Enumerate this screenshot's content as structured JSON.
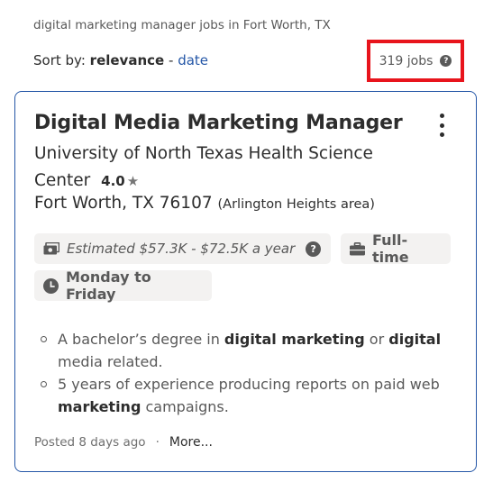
{
  "search": {
    "query_text": "digital marketing manager jobs in Fort Worth, TX"
  },
  "sort": {
    "label": "Sort by:",
    "active": "relevance",
    "separator": "-",
    "alternate": "date"
  },
  "results": {
    "count_label": "319 jobs",
    "help_glyph": "?"
  },
  "job": {
    "title": "Digital Media Marketing Manager",
    "company": "University of North Texas Health Science Center",
    "rating": "4.0",
    "rating_star": "★",
    "location": "Fort Worth, TX 76107",
    "location_area": "(Arlington Heights area)",
    "salary": "Estimated $57.3K - $72.5K a year",
    "salary_help_glyph": "?",
    "job_type": "Full-time",
    "schedule": "Monday to Friday",
    "bullets": [
      {
        "t1": "A bachelor’s degree in ",
        "b1": "digital marketing",
        "t2": " or ",
        "b2": "digital",
        "t3": " media related."
      },
      {
        "t1": "5 years of experience producing reports on paid web ",
        "b1": "marketing",
        "t2": " campaigns."
      }
    ],
    "posted": "Posted 8 days ago",
    "dot": "·",
    "more_label": "More..."
  },
  "colors": {
    "accent": "#2557a7",
    "highlight_box": "#e8141c",
    "chip_bg": "#f3f2f1",
    "text_primary": "#2d2d2d",
    "text_secondary": "#595959"
  },
  "icons": {
    "kebab": "vertical-ellipsis-icon",
    "salary": "money-bill-icon",
    "job_type": "briefcase-icon",
    "schedule": "clock-icon",
    "help": "question-circle-icon",
    "star": "star-icon"
  }
}
